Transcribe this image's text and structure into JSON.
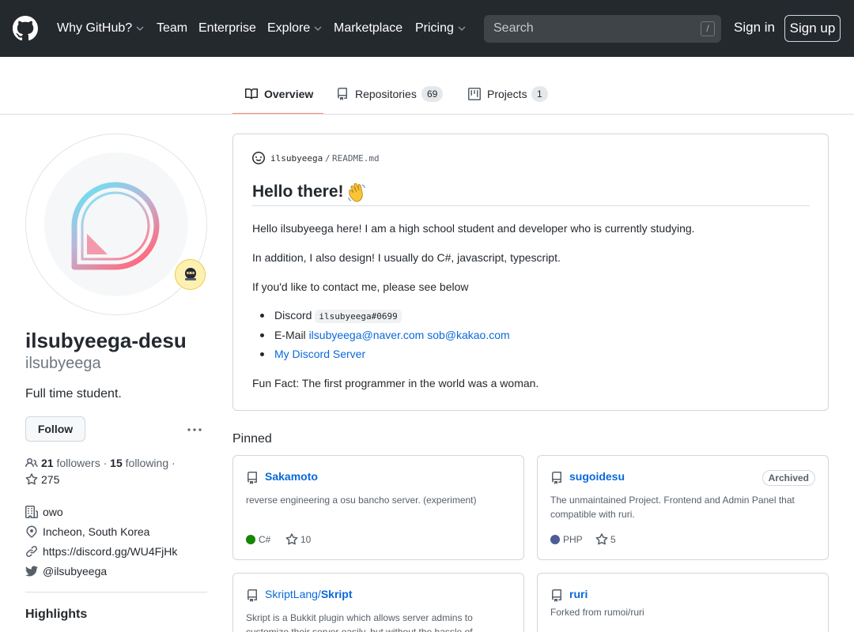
{
  "header": {
    "nav": [
      {
        "label": "Why GitHub?",
        "has_caret": true
      },
      {
        "label": "Team",
        "has_caret": false
      },
      {
        "label": "Enterprise",
        "has_caret": false
      },
      {
        "label": "Explore",
        "has_caret": true
      },
      {
        "label": "Marketplace",
        "has_caret": false
      },
      {
        "label": "Pricing",
        "has_caret": true
      }
    ],
    "search_placeholder": "Search",
    "search_hotkey": "/",
    "sign_in": "Sign in",
    "sign_up": "Sign up"
  },
  "tabs": [
    {
      "label": "Overview",
      "icon": "book-icon",
      "active": true
    },
    {
      "label": "Repositories",
      "icon": "repo-icon",
      "count": "69"
    },
    {
      "label": "Projects",
      "icon": "project-icon",
      "count": "1"
    }
  ],
  "profile": {
    "name": "ilsubyeega-desu",
    "login": "ilsubyeega",
    "bio": "Full time student.",
    "follow_label": "Follow",
    "followers_count": "21",
    "followers_label": "followers",
    "following_count": "15",
    "following_label": "following",
    "separator": "·",
    "stars": "275",
    "company": "owo",
    "location": "Incheon, South Korea",
    "website": "https://discord.gg/WU4FjHk",
    "twitter": "@ilsubyeega",
    "highlights_heading": "Highlights",
    "status_icon": "ninja-emoji-icon"
  },
  "readme": {
    "path_user": "ilsubyeega",
    "path_sep": "/",
    "path_file": "README.md",
    "heading": "Hello there!",
    "heading_emoji": "waving-hand-icon",
    "p1": "Hello ilsubyeega here! I am a high school student and developer who is currently studying.",
    "p2": "In addition, I also design! I usually do C#, javascript, typescript.",
    "p3": "If you'd like to contact me, please see below",
    "li1_text": "Discord",
    "li1_code": "ilsubyeega#0699",
    "li2_text": "E-Mail",
    "li2_link1": "ilsubyeega@naver.com",
    "li2_link2": "sob@kakao.com",
    "li3_link": "My Discord Server",
    "fun_fact": "Fun Fact: The first programmer in the world was a woman."
  },
  "pinned": {
    "heading": "Pinned",
    "repos": [
      {
        "owner": "",
        "name": "Sakamoto",
        "description": "reverse engineering a osu bancho server. (experiment)",
        "language": "C#",
        "language_color": "#178600",
        "stars": "10"
      },
      {
        "owner": "",
        "name": "sugoidesu",
        "badge": "Archived",
        "description": "The unmaintained Project. Frontend and Admin Panel that compatible with ruri.",
        "language": "PHP",
        "language_color": "#4F5D95",
        "stars": "5"
      },
      {
        "owner": "SkriptLang/",
        "name": "Skript",
        "description": "Skript is a Bukkit plugin which allows server admins to customize their server easily, but without the hassle of"
      },
      {
        "owner": "",
        "name": "ruri",
        "description": "Forked from rumoi/ruri"
      }
    ]
  },
  "colors": {
    "header_bg": "#24292e",
    "link": "#0969da",
    "tab_underline": "#fd8c73"
  }
}
